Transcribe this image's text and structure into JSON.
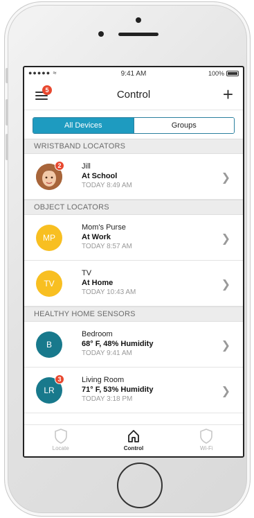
{
  "status_bar": {
    "carrier": "●●●●● ≈",
    "time": "9:41 AM",
    "battery": "100%"
  },
  "nav": {
    "title": "Control",
    "menu_badge": "5",
    "add_label": "+"
  },
  "segments": [
    {
      "label": "All Devices",
      "active": true
    },
    {
      "label": "Groups",
      "active": false
    }
  ],
  "sections": {
    "wristband": {
      "header": "WRISTBAND LOCATORS",
      "items": [
        {
          "name": "Jill",
          "status": "At School",
          "time": "TODAY 8:49 AM",
          "badge": "2"
        }
      ]
    },
    "object": {
      "header": "OBJECT LOCATORS",
      "items": [
        {
          "initials": "MP",
          "name": "Mom's Purse",
          "status": "At Work",
          "time": "TODAY 8:57 AM"
        },
        {
          "initials": "TV",
          "name": "TV",
          "status": "At Home",
          "time": "TODAY 10:43 AM"
        }
      ]
    },
    "home": {
      "header": "HEALTHY HOME SENSORS",
      "items": [
        {
          "initials": "B",
          "name": "Bedroom",
          "status": "68° F, 48% Humidity",
          "time": "TODAY 9:41 AM"
        },
        {
          "initials": "LR",
          "name": "Living Room",
          "status": "71° F, 53% Humidity",
          "time": "TODAY 3:18 PM",
          "badge": "3"
        }
      ]
    }
  },
  "tabs": [
    {
      "label": "Locate"
    },
    {
      "label": "Control"
    },
    {
      "label": "Wi-Fi"
    }
  ],
  "colors": {
    "accent": "#1e9bc0",
    "badge": "#e8482f",
    "yellow": "#f8bf21",
    "teal": "#18798c"
  }
}
